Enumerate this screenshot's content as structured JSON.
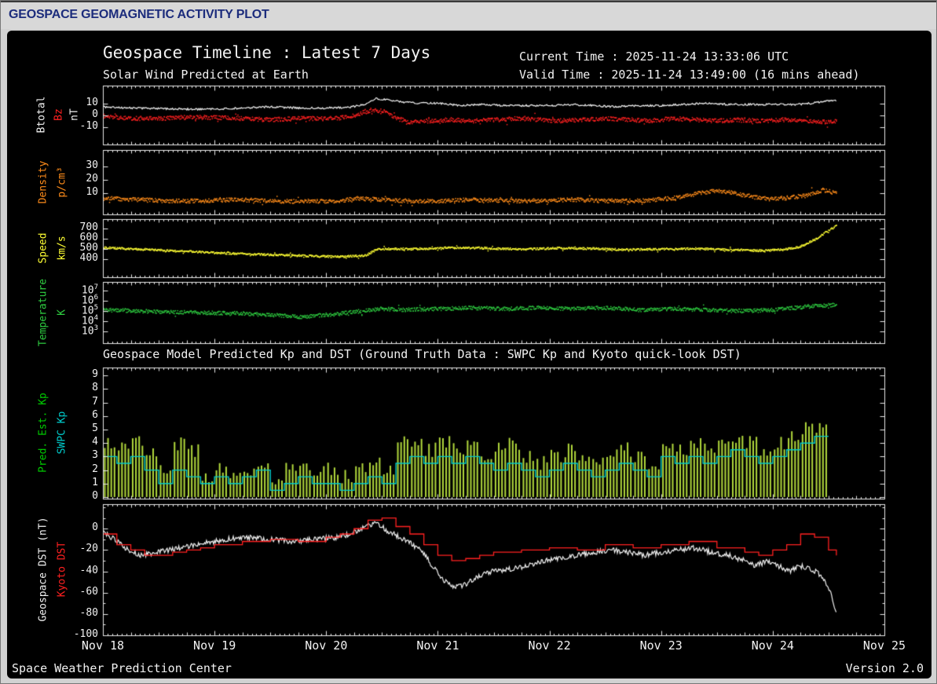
{
  "header": {
    "title": "GEOSPACE GEOMAGNETIC ACTIVITY PLOT"
  },
  "titles": {
    "main": "Geospace Timeline : Latest 7 Days",
    "current_time": "Current Time : 2025-11-24 13:33:06 UTC",
    "solar_wind": "Solar Wind Predicted at Earth",
    "valid_time": "Valid Time : 2025-11-24 13:49:00 (16 mins ahead)",
    "section2": "Geospace Model Predicted Kp and DST (Ground Truth Data : SWPC Kp and Kyoto quick-look DST)"
  },
  "footer": {
    "left": "Space Weather Prediction Center",
    "right": "Version 2.0"
  },
  "colors": {
    "background": "#000000",
    "page": "#d2d2d2",
    "header_text": "#1c2c7c",
    "axis": "#e8e8e8",
    "btotal": "#f2f2f2",
    "bz": "#ff2020",
    "density": "#ff8c1a",
    "speed": "#ffff33",
    "temperature": "#2ecc40",
    "kp_pred": "#b2d93c",
    "kp_swpc": "#00cccc",
    "dst_geospace": "#f2f2f2",
    "dst_kyoto": "#ff2020"
  },
  "ylabels": {
    "p1a": "Btotal",
    "p1b": "Bz",
    "p1c": "nT",
    "p2a": "Density",
    "p2b": "p/cm³",
    "p3a": "Speed",
    "p3b": "km/s",
    "p4a": "Temperature",
    "p4b": "K",
    "p5a": "Pred. Est. Kp",
    "p5b": "SWPC Kp",
    "p6a": "Geospace DST (nT)",
    "p6b": "Kyoto DST"
  },
  "chart_data": {
    "type": "line",
    "title": "Geospace Timeline : Latest 7 Days",
    "x_unit": "days since 2025-11-18 00:00 UTC",
    "xlim": [
      0,
      7
    ],
    "xtick_labels": [
      "Nov 18",
      "Nov 19",
      "Nov 20",
      "Nov 21",
      "Nov 22",
      "Nov 23",
      "Nov 24",
      "Nov 25"
    ],
    "panels": [
      {
        "id": "imf",
        "ylim": [
          -25,
          25
        ],
        "yticks": [
          {
            "v": 10,
            "label": "10"
          },
          {
            "v": 0,
            "label": "0"
          },
          {
            "v": -10,
            "label": "-10"
          }
        ],
        "series": [
          {
            "name": "Btotal",
            "color": "#f2f2f2",
            "render": "line",
            "jitter": 0.8,
            "x": [
              0,
              0.25,
              0.5,
              0.75,
              1,
              1.25,
              1.5,
              1.75,
              2,
              2.2,
              2.35,
              2.45,
              2.55,
              2.7,
              2.85,
              3,
              3.2,
              3.4,
              3.6,
              3.8,
              4,
              4.2,
              4.4,
              4.6,
              4.8,
              5,
              5.2,
              5.4,
              5.6,
              5.8,
              6,
              6.2,
              6.35,
              6.5,
              6.57
            ],
            "y": [
              7,
              6,
              5.5,
              5,
              5,
              6,
              7,
              6,
              6,
              6.5,
              9,
              14,
              13,
              11,
              10,
              10,
              8,
              9,
              8,
              8,
              8,
              9,
              8,
              7,
              8,
              8,
              9,
              10,
              9,
              9,
              9,
              9,
              10,
              12,
              12
            ]
          },
          {
            "name": "Bz",
            "color": "#ff2020",
            "render": "scatter",
            "jitter": 1.8,
            "x": [
              0,
              0.25,
              0.5,
              0.75,
              1,
              1.25,
              1.5,
              1.75,
              2,
              2.2,
              2.35,
              2.5,
              2.6,
              2.75,
              2.9,
              3.1,
              3.3,
              3.5,
              3.7,
              3.9,
              4.1,
              4.3,
              4.5,
              4.7,
              4.9,
              5.1,
              5.3,
              5.5,
              5.7,
              5.9,
              6.1,
              6.3,
              6.45,
              6.57
            ],
            "y": [
              -1,
              -3,
              -3,
              -2,
              -2,
              -3,
              -4,
              -3,
              -3,
              -2,
              3,
              4,
              -2,
              -6,
              -5,
              -4,
              -5,
              -4,
              -3,
              -4,
              -5,
              -4,
              -3,
              -4,
              -5,
              -3,
              -4,
              -5,
              -4,
              -5,
              -4,
              -5,
              -6,
              -5
            ]
          }
        ]
      },
      {
        "id": "density",
        "ylim": [
          -6,
          42
        ],
        "yticks": [
          {
            "v": 30,
            "label": "30"
          },
          {
            "v": 20,
            "label": "20"
          },
          {
            "v": 10,
            "label": "10"
          }
        ],
        "series": [
          {
            "name": "Density",
            "color": "#ff8c1a",
            "render": "scatter",
            "jitter": 1.5,
            "clamp_min": 0.4,
            "x": [
              0,
              0.3,
              0.6,
              0.9,
              1.2,
              1.5,
              1.8,
              2.1,
              2.3,
              2.5,
              2.7,
              3,
              3.3,
              3.6,
              3.9,
              4.2,
              4.5,
              4.8,
              5.1,
              5.3,
              5.5,
              5.7,
              5.9,
              6.1,
              6.3,
              6.45,
              6.57
            ],
            "y": [
              6,
              5,
              4,
              4,
              5,
              4,
              3.5,
              4,
              6,
              5,
              4,
              4,
              5,
              4,
              4,
              5,
              4,
              4,
              6,
              9,
              12,
              9,
              6,
              6,
              8,
              12,
              10
            ]
          }
        ]
      },
      {
        "id": "speed",
        "ylim": [
          220,
          790
        ],
        "yticks": [
          {
            "v": 700,
            "label": "700"
          },
          {
            "v": 600,
            "label": "600"
          },
          {
            "v": 500,
            "label": "500"
          },
          {
            "v": 400,
            "label": "400"
          }
        ],
        "series": [
          {
            "name": "Speed",
            "color": "#ffff33",
            "render": "scatter",
            "jitter": 10,
            "x": [
              0,
              0.3,
              0.6,
              0.9,
              1.2,
              1.5,
              1.8,
              2.1,
              2.35,
              2.45,
              2.6,
              2.8,
              3,
              3.2,
              3.5,
              3.8,
              4.1,
              4.4,
              4.7,
              5,
              5.3,
              5.6,
              5.9,
              6.1,
              6.25,
              6.4,
              6.5,
              6.57
            ],
            "y": [
              510,
              495,
              480,
              465,
              450,
              440,
              430,
              420,
              430,
              490,
              500,
              495,
              505,
              510,
              500,
              495,
              505,
              500,
              490,
              495,
              500,
              490,
              480,
              490,
              520,
              600,
              680,
              720
            ]
          }
        ]
      },
      {
        "id": "temperature",
        "ylog": true,
        "ylim": [
          70,
          70000000
        ],
        "yticks": [
          {
            "v": 10000000,
            "label": "10^7"
          },
          {
            "v": 1000000,
            "label": "10^6"
          },
          {
            "v": 100000,
            "label": "10^5"
          },
          {
            "v": 10000,
            "label": "10^4"
          },
          {
            "v": 1000,
            "label": "10^3"
          }
        ],
        "series": [
          {
            "name": "Temperature",
            "color": "#2ecc40",
            "render": "scatter",
            "jitter": 0.18,
            "x": [
              0,
              0.3,
              0.6,
              0.9,
              1.2,
              1.5,
              1.8,
              2.1,
              2.35,
              2.5,
              2.7,
              3,
              3.3,
              3.6,
              3.9,
              4.2,
              4.5,
              4.8,
              5.1,
              5.4,
              5.7,
              6,
              6.2,
              6.4,
              6.57
            ],
            "y": [
              125000,
              100000,
              80000,
              65000,
              60000,
              40000,
              25000,
              50000,
              100000,
              160000,
              130000,
              160000,
              200000,
              160000,
              200000,
              160000,
              200000,
              125000,
              160000,
              125000,
              100000,
              125000,
              200000,
              320000,
              400000
            ]
          }
        ]
      },
      {
        "id": "kp",
        "ylim": [
          -0.12,
          9.6
        ],
        "yticks": [
          {
            "v": 9,
            "label": "9"
          },
          {
            "v": 8,
            "label": "8"
          },
          {
            "v": 7,
            "label": "7"
          },
          {
            "v": 6,
            "label": "6"
          },
          {
            "v": 5,
            "label": "5"
          },
          {
            "v": 4,
            "label": "4"
          },
          {
            "v": 3,
            "label": "3"
          },
          {
            "v": 2,
            "label": "2"
          },
          {
            "v": 1,
            "label": "1"
          },
          {
            "v": 0,
            "label": "0"
          }
        ],
        "series": [
          {
            "name": "Pred. Est. Kp",
            "color": "#b2d93c",
            "render": "ensemble-bars",
            "dt_days": 0.125,
            "values": [
              4,
              3.5,
              4,
              3.5,
              2,
              4,
              3.5,
              1.5,
              2,
              1.5,
              2,
              2.5,
              1,
              2,
              2.5,
              2,
              2,
              1.5,
              2,
              2.5,
              2,
              4,
              4,
              3.5,
              4,
              3.5,
              4,
              3,
              3.5,
              4,
              3,
              2.5,
              3,
              3.5,
              3,
              2.5,
              3,
              3.5,
              3,
              2.5,
              4,
              3.5,
              4,
              3.5,
              4,
              4.5,
              4,
              3.5,
              4,
              4.5,
              5,
              5
            ]
          },
          {
            "name": "SWPC Kp",
            "color": "#00cccc",
            "render": "step-values",
            "dt_days": 0.125,
            "values": [
              3,
              2.5,
              3,
              2,
              1,
              2,
              1.5,
              1,
              1.5,
              1,
              1.5,
              2,
              0.5,
              1,
              1.5,
              1,
              1,
              0.5,
              1,
              1.5,
              1,
              2.5,
              3,
              2.5,
              3,
              2.5,
              3,
              2.5,
              2,
              2.5,
              2,
              1.5,
              2,
              2.5,
              2,
              1.5,
              2,
              2.5,
              2,
              1.5,
              3,
              2.5,
              3,
              2.5,
              3,
              3.5,
              3,
              2.5,
              3,
              3.5,
              4,
              4.5
            ]
          }
        ]
      },
      {
        "id": "dst",
        "ylim": [
          -100,
          23
        ],
        "yminor": 10,
        "yticks": [
          {
            "v": 0,
            "label": "0"
          },
          {
            "v": -20,
            "label": "-20"
          },
          {
            "v": -40,
            "label": "-40"
          },
          {
            "v": -60,
            "label": "-60"
          },
          {
            "v": -80,
            "label": "-80"
          },
          {
            "v": -100,
            "label": "-100"
          }
        ],
        "series": [
          {
            "name": "Geospace DST",
            "color": "#f2f2f2",
            "render": "line",
            "jitter": 2.5,
            "x": [
              0,
              0.1,
              0.25,
              0.35,
              0.5,
              0.7,
              0.9,
              1.1,
              1.3,
              1.5,
              1.7,
              1.9,
              2.1,
              2.25,
              2.35,
              2.45,
              2.55,
              2.7,
              2.85,
              2.95,
              3.05,
              3.15,
              3.25,
              3.35,
              3.5,
              3.65,
              3.8,
              3.95,
              4.1,
              4.25,
              4.4,
              4.55,
              4.7,
              4.85,
              5,
              5.15,
              5.3,
              5.45,
              5.6,
              5.75,
              5.85,
              5.95,
              6.05,
              6.15,
              6.25,
              6.35,
              6.45,
              6.52,
              6.57
            ],
            "y": [
              -2,
              -10,
              -22,
              -25,
              -22,
              -18,
              -14,
              -10,
              -8,
              -10,
              -12,
              -10,
              -8,
              -4,
              2,
              5,
              -2,
              -10,
              -20,
              -35,
              -48,
              -55,
              -52,
              -45,
              -40,
              -38,
              -35,
              -30,
              -28,
              -25,
              -22,
              -20,
              -22,
              -25,
              -22,
              -20,
              -18,
              -22,
              -25,
              -30,
              -35,
              -30,
              -35,
              -40,
              -35,
              -38,
              -45,
              -60,
              -80
            ]
          },
          {
            "name": "Kyoto DST",
            "color": "#ff2020",
            "render": "step",
            "x": [
              0,
              0.125,
              0.25,
              0.375,
              0.5,
              0.625,
              0.75,
              0.875,
              1,
              1.25,
              1.5,
              1.75,
              2,
              2.125,
              2.25,
              2.375,
              2.5,
              2.625,
              2.75,
              2.875,
              3,
              3.125,
              3.25,
              3.375,
              3.5,
              3.75,
              4,
              4.25,
              4.5,
              4.75,
              5,
              5.25,
              5.5,
              5.75,
              5.875,
              6,
              6.125,
              6.25,
              6.375,
              6.5,
              6.57
            ],
            "y": [
              -5,
              -15,
              -20,
              -25,
              -25,
              -22,
              -20,
              -18,
              -15,
              -12,
              -10,
              -12,
              -8,
              -5,
              0,
              8,
              10,
              2,
              -5,
              -15,
              -25,
              -30,
              -28,
              -25,
              -22,
              -20,
              -18,
              -20,
              -15,
              -18,
              -15,
              -12,
              -18,
              -22,
              -25,
              -20,
              -15,
              -5,
              -8,
              -20,
              -25
            ]
          }
        ]
      }
    ]
  }
}
